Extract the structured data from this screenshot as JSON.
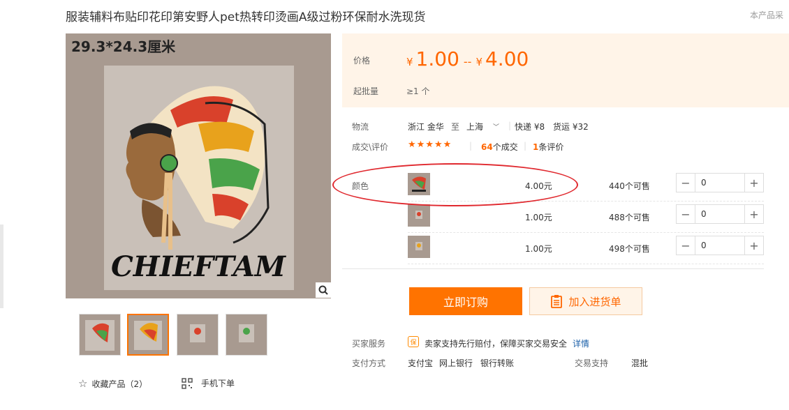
{
  "product": {
    "title": "服装辅料布贴印花印第安野人pet热转印烫画A级过粉环保耐水洗现货",
    "side_note": "本产品采",
    "size_label": "29.3*24.3厘米",
    "image_text": "CHIEFTAM"
  },
  "price": {
    "label": "价格",
    "currency": "¥",
    "low": "1.00",
    "sep": "--",
    "high": "4.00",
    "moq_label": "起批量",
    "moq_value": "≥1 个"
  },
  "logistics": {
    "label": "物流",
    "from": "浙江 金华",
    "to_word": "至",
    "to": "上海",
    "express": "快递 ¥8",
    "freight": "货运 ¥32"
  },
  "deals": {
    "label": "成交\\评价",
    "stars": "★★★★★",
    "deal_count": "64",
    "deal_unit": "个成交",
    "review_count": "1",
    "review_unit": "条评价"
  },
  "color_label": "颜色",
  "skus": [
    {
      "price": "4.00元",
      "stock": "440个可售",
      "qty": "0"
    },
    {
      "price": "1.00元",
      "stock": "488个可售",
      "qty": "0"
    },
    {
      "price": "1.00元",
      "stock": "498个可售",
      "qty": "0"
    }
  ],
  "buttons": {
    "buy": "立即订购",
    "cart": "加入进货单"
  },
  "service": {
    "label": "买家服务",
    "icon_text": "保",
    "text": "卖家支持先行赔付，保障买家交易安全",
    "link": "详情"
  },
  "payment": {
    "label": "支付方式",
    "methods": [
      "支付宝",
      "网上银行",
      "银行转账"
    ],
    "trade_label": "交易支持",
    "trade_value": "混批"
  },
  "footer": {
    "favorite": "收藏产品（2）",
    "mobile": "手机下单"
  },
  "colors": {
    "accent": "#ff6600",
    "button": "#ff7300",
    "price_bg": "#fff4e8",
    "highlight_ellipse": "#e0282e"
  }
}
